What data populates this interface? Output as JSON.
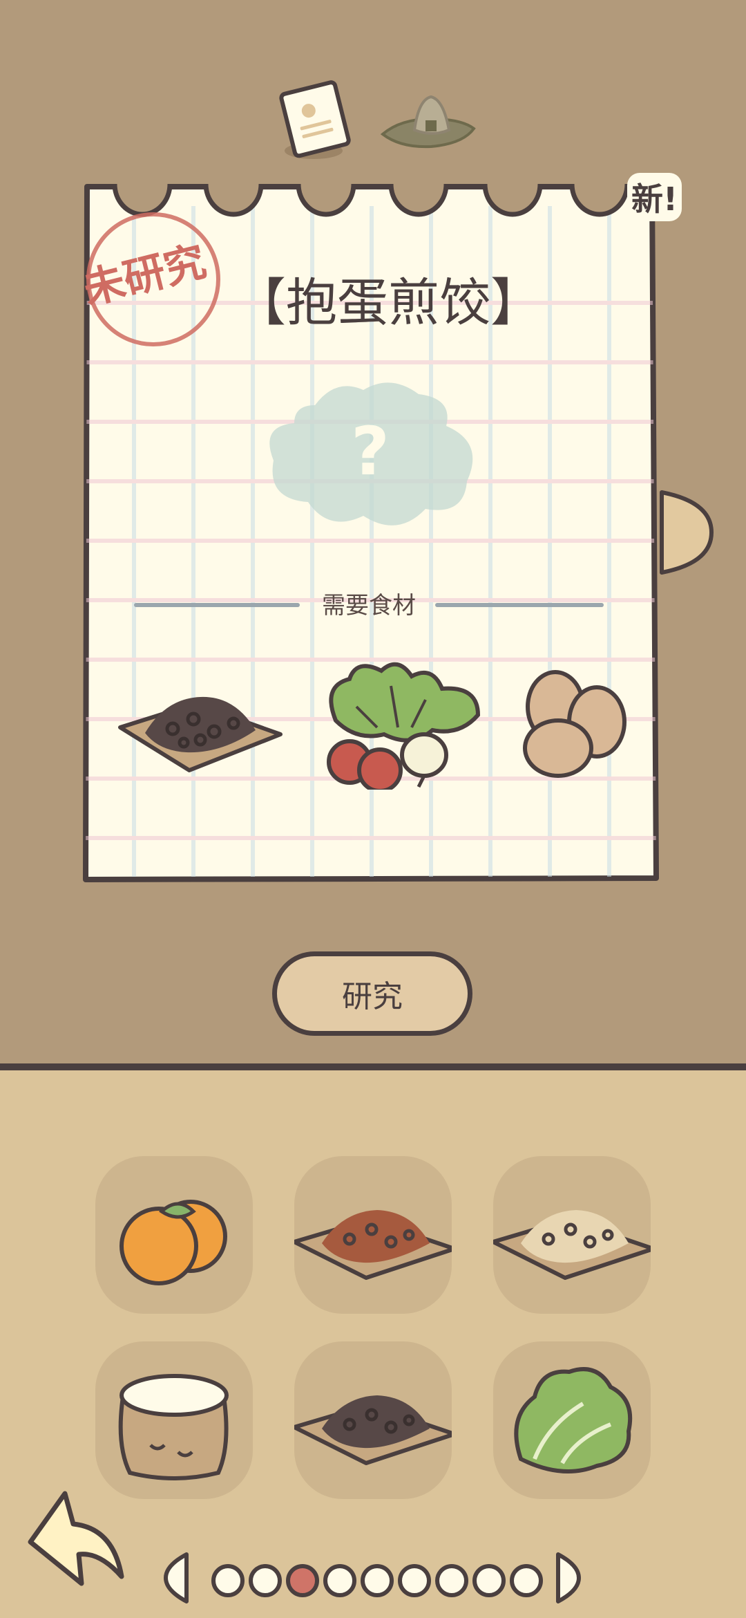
{
  "recipe": {
    "title": "【抱蛋煎饺】",
    "status_stamp": "未研究",
    "new_badge": "新!",
    "ingredients_label": "需要食材",
    "required_ingredients": [
      "meat-crumbles-icon",
      "radish-greens-icon",
      "eggs-icon"
    ]
  },
  "research_button": {
    "label": "研究"
  },
  "inventory": [
    {
      "name": "mandarin-orange-icon"
    },
    {
      "name": "minced-meat-icon"
    },
    {
      "name": "fried-rice-icon"
    },
    {
      "name": "flour-sack-icon"
    },
    {
      "name": "meat-crumbles-icon"
    },
    {
      "name": "lettuce-icon"
    }
  ],
  "pager": {
    "total": 9,
    "active": 3
  },
  "colors": {
    "background_top": "#b29a7b",
    "background_bottom": "#dbc49a",
    "outline": "#4a3f3f",
    "paper": "#fffbe9",
    "stamp": "#cf6c62",
    "active_dot": "#cf7468"
  }
}
